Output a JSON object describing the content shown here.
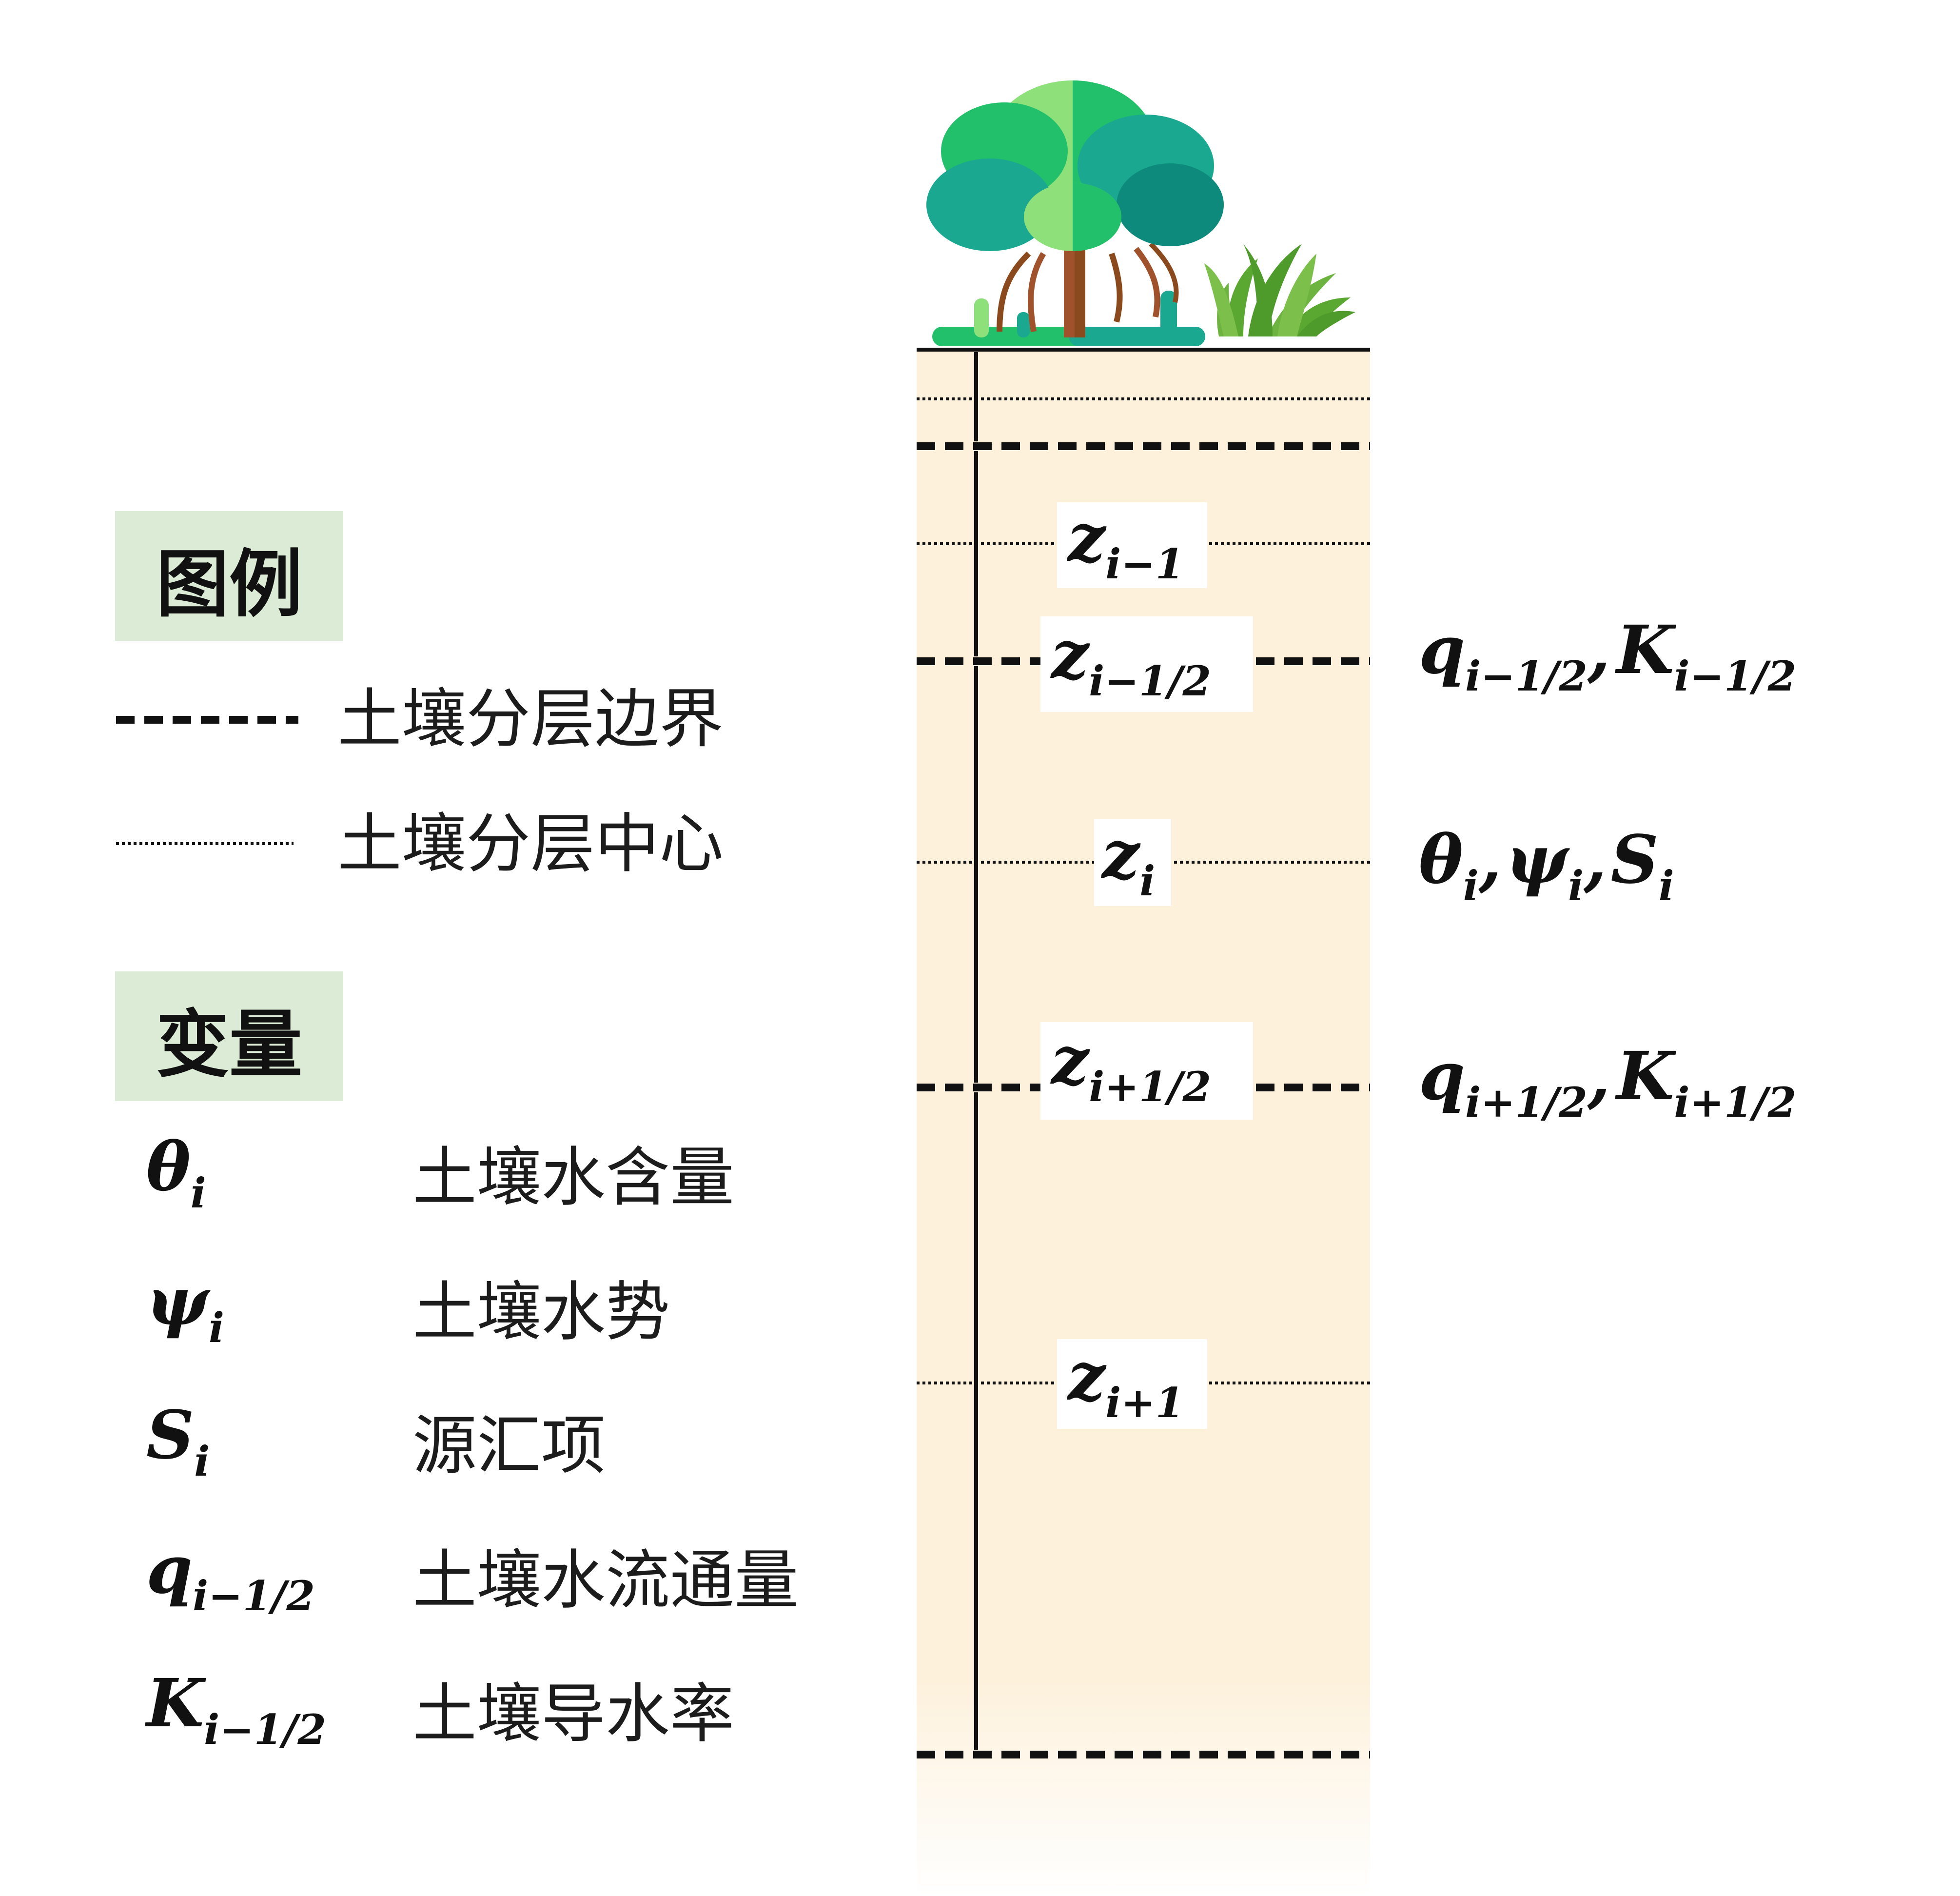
{
  "legend": {
    "title": "图例",
    "boundary_label": "土壤分层边界",
    "center_label": "土壤分层中心"
  },
  "variables": {
    "title": "变量",
    "items": [
      {
        "sym": "θ",
        "sub": "i",
        "desc": "土壤水含量"
      },
      {
        "sym": "ψ",
        "sub": "i",
        "desc": "土壤水势"
      },
      {
        "sym": "S",
        "sub": "i",
        "desc": "源汇项"
      },
      {
        "sym": "q",
        "sub": "i−1/2",
        "desc": "土壤水流通量"
      },
      {
        "sym": "K",
        "sub": "i−1/2",
        "desc": "土壤导水率"
      }
    ]
  },
  "column_labels": {
    "z_im1": {
      "sym": "z",
      "sub": "i−1"
    },
    "z_imh": {
      "sym": "z",
      "sub": "i−1/2"
    },
    "z_i": {
      "sym": "z",
      "sub": "i"
    },
    "z_iph": {
      "sym": "z",
      "sub": "i+1/2"
    },
    "z_ip1": {
      "sym": "z",
      "sub": "i+1"
    }
  },
  "right_labels": {
    "upper_flux": [
      {
        "sym": "q",
        "sub": "i−1/2"
      },
      {
        "sym": "K",
        "sub": "i−1/2"
      }
    ],
    "center_state": [
      {
        "sym": "θ",
        "sub": "i"
      },
      {
        "sym": "ψ",
        "sub": "i"
      },
      {
        "sym": "S",
        "sub": "i"
      }
    ],
    "lower_flux": [
      {
        "sym": "q",
        "sub": "i+1/2"
      },
      {
        "sym": "K",
        "sub": "i+1/2"
      }
    ]
  },
  "colors": {
    "soil": "#fdf1dc",
    "legend_box": "#dcebd6",
    "line": "#111111",
    "tree_light": "#8ee07a",
    "tree_mid": "#22c06a",
    "tree_teal": "#1aa890",
    "tree_dark": "#0e8a7c",
    "trunk": "#a0522d",
    "grass": "#5aa832"
  },
  "icons": [
    "tree-icon",
    "grass-icon"
  ]
}
